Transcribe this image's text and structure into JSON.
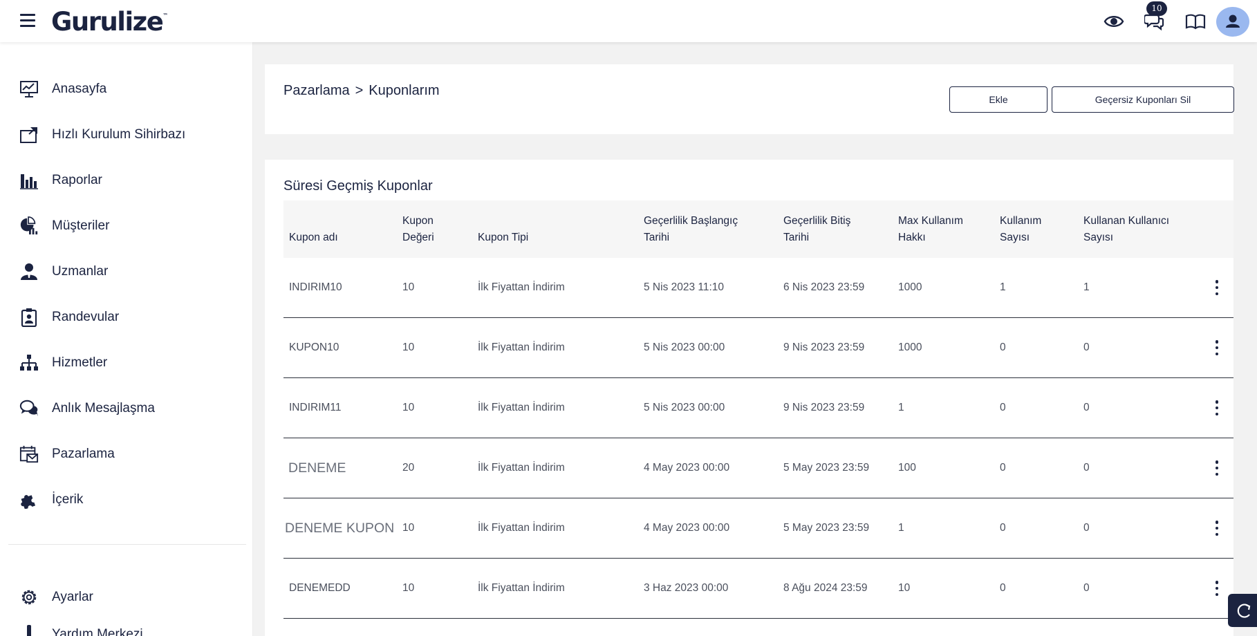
{
  "app": {
    "logo": "Gurulize",
    "logo_tm": "™"
  },
  "topbar": {
    "notification_count": "10"
  },
  "sidebar": {
    "items": [
      {
        "label": "Anasayfa",
        "icon": "monitor-chart-icon"
      },
      {
        "label": "Hızlı Kurulum Sihirbazı",
        "icon": "setup-wizard-icon"
      },
      {
        "label": "Raporlar",
        "icon": "bar-chart-icon"
      },
      {
        "label": "Müşteriler",
        "icon": "customers-pie-icon"
      },
      {
        "label": "Uzmanlar",
        "icon": "expert-user-icon"
      },
      {
        "label": "Randevular",
        "icon": "clipboard-user-icon"
      },
      {
        "label": "Hizmetler",
        "icon": "sitemap-icon"
      },
      {
        "label": "Anlık Mesajlaşma",
        "icon": "chat-bubbles-icon"
      },
      {
        "label": "Pazarlama",
        "icon": "calendar-mail-icon"
      },
      {
        "label": "İçerik",
        "icon": "puzzle-icon"
      }
    ],
    "bottom_items": [
      {
        "label": "Ayarlar",
        "icon": "gear-icon"
      },
      {
        "label": "Yardım Merkezi",
        "icon": "exclamation-icon"
      }
    ]
  },
  "breadcrumb": {
    "parent": "Pazarlama",
    "separator": ">",
    "current": "Kuponlarım"
  },
  "actions": {
    "add_label": "Ekle",
    "delete_invalid_label": "Geçersiz Kuponları Sil"
  },
  "table": {
    "title": "Süresi Geçmiş Kuponlar",
    "headers": {
      "name": "Kupon adı",
      "value_l1": "Kupon",
      "value_l2": "Değeri",
      "type": "Kupon Tipi",
      "start_l1": "Geçerlilik Başlangıç",
      "start_l2": "Tarihi",
      "end_l1": "Geçerlilik Bitiş",
      "end_l2": "Tarihi",
      "max_l1": "Max Kullanım",
      "max_l2": "Hakkı",
      "usage_l1": "Kullanım",
      "usage_l2": "Sayısı",
      "users_l1": "Kullanan Kullanıcı",
      "users_l2": "Sayısı"
    },
    "rows": [
      {
        "name": "INDIRIM10",
        "value": "10",
        "type": "İlk Fiyattan İndirim",
        "start": "5 Nis 2023 11:10",
        "end": "6 Nis 2023 23:59",
        "max": "1000",
        "usage": "1",
        "users": "1"
      },
      {
        "name": "KUPON10",
        "value": "10",
        "type": "İlk Fiyattan İndirim",
        "start": "5 Nis 2023 00:00",
        "end": "9 Nis 2023 23:59",
        "max": "1000",
        "usage": "0",
        "users": "0"
      },
      {
        "name": "INDIRIM11",
        "value": "10",
        "type": "İlk Fiyattan İndirim",
        "start": "5 Nis 2023 00:00",
        "end": "9 Nis 2023 23:59",
        "max": "1",
        "usage": "0",
        "users": "0"
      },
      {
        "name": "DENEME",
        "value": "20",
        "type": "İlk Fiyattan İndirim",
        "start": "4 May 2023 00:00",
        "end": "5 May 2023 23:59",
        "max": "100",
        "usage": "0",
        "users": "0"
      },
      {
        "name": "DENEME KUPON",
        "value": "10",
        "type": "İlk Fiyattan İndirim",
        "start": "4 May 2023 00:00",
        "end": "5 May 2023 23:59",
        "max": "1",
        "usage": "0",
        "users": "0"
      },
      {
        "name": "DENEMEDD",
        "value": "10",
        "type": "İlk Fiyattan İndirim",
        "start": "3 Haz 2023 00:00",
        "end": "8 Ağu 2024 23:59",
        "max": "10",
        "usage": "0",
        "users": "0"
      }
    ]
  },
  "colors": {
    "primary": "#1b2340",
    "avatar": "#9ab8ef",
    "background": "#f2f2f2"
  }
}
